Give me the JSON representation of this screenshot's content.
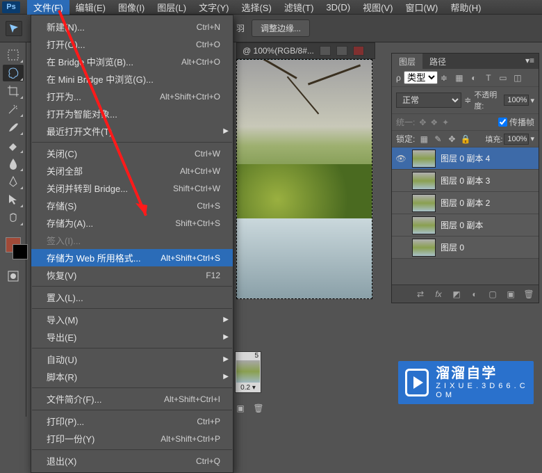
{
  "app": {
    "logo": "Ps"
  },
  "menubar": [
    "文件(F)",
    "编辑(E)",
    "图像(I)",
    "图层(L)",
    "文字(Y)",
    "选择(S)",
    "滤镜(T)",
    "3D(D)",
    "视图(V)",
    "窗口(W)",
    "帮助(H)"
  ],
  "optbar": {
    "feather_icon": "羽",
    "refine": "调整边缘..."
  },
  "document": {
    "title_suffix": "@ 100%(RGB/8#..."
  },
  "timeline": {
    "frames": [
      {
        "index": "5",
        "duration": "0.2 ▾"
      }
    ]
  },
  "file_menu": {
    "groups": [
      [
        {
          "label": "新建(N)...",
          "short": "Ctrl+N"
        },
        {
          "label": "打开(O)...",
          "short": "Ctrl+O"
        },
        {
          "label": "在 Bridge 中浏览(B)...",
          "short": "Alt+Ctrl+O"
        },
        {
          "label": "在 Mini Bridge 中浏览(G)..."
        },
        {
          "label": "打开为...",
          "short": "Alt+Shift+Ctrl+O"
        },
        {
          "label": "打开为智能对象..."
        },
        {
          "label": "最近打开文件(T)",
          "sub": true
        }
      ],
      [
        {
          "label": "关闭(C)",
          "short": "Ctrl+W"
        },
        {
          "label": "关闭全部",
          "short": "Alt+Ctrl+W"
        },
        {
          "label": "关闭并转到 Bridge...",
          "short": "Shift+Ctrl+W"
        },
        {
          "label": "存储(S)",
          "short": "Ctrl+S"
        },
        {
          "label": "存储为(A)...",
          "short": "Shift+Ctrl+S"
        },
        {
          "label": "签入(I)...",
          "disabled": true
        },
        {
          "label": "存储为 Web 所用格式...",
          "short": "Alt+Shift+Ctrl+S",
          "hl": true
        },
        {
          "label": "恢复(V)",
          "short": "F12"
        }
      ],
      [
        {
          "label": "置入(L)..."
        }
      ],
      [
        {
          "label": "导入(M)",
          "sub": true
        },
        {
          "label": "导出(E)",
          "sub": true
        }
      ],
      [
        {
          "label": "自动(U)",
          "sub": true
        },
        {
          "label": "脚本(R)",
          "sub": true
        }
      ],
      [
        {
          "label": "文件简介(F)...",
          "short": "Alt+Shift+Ctrl+I"
        }
      ],
      [
        {
          "label": "打印(P)...",
          "short": "Ctrl+P"
        },
        {
          "label": "打印一份(Y)",
          "short": "Alt+Shift+Ctrl+P"
        }
      ],
      [
        {
          "label": "退出(X)",
          "short": "Ctrl+Q"
        }
      ]
    ]
  },
  "layers_panel": {
    "tabs": [
      "图层",
      "路径"
    ],
    "kind_label": "类型",
    "blend_mode": "正常",
    "opacity_label": "不透明度:",
    "opacity_value": "100%",
    "unify_label": "统一:",
    "propagate": "传播帧",
    "lock_label": "锁定:",
    "fill_label": "填充:",
    "fill_value": "100%",
    "layers": [
      {
        "name": "图层 0 副本 4",
        "eye": true
      },
      {
        "name": "图层 0 副本 3"
      },
      {
        "name": "图层 0 副本 2"
      },
      {
        "name": "图层 0 副本"
      },
      {
        "name": "图层 0"
      }
    ]
  },
  "watermark": {
    "title": "溜溜自学",
    "sub": "Z I X U E . 3 D 6 6 . C O M"
  }
}
